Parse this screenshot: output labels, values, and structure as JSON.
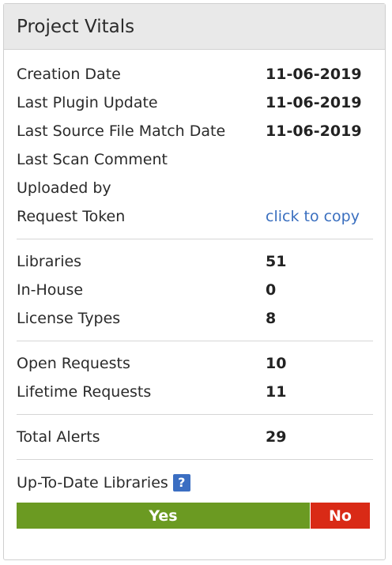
{
  "panel": {
    "title": "Project Vitals"
  },
  "sections": [
    [
      {
        "label": "Creation Date",
        "value": "11-06-2019"
      },
      {
        "label": "Last Plugin Update",
        "value": "11-06-2019"
      },
      {
        "label": "Last Source File Match Date",
        "value": "11-06-2019"
      },
      {
        "label": "Last Scan Comment",
        "value": ""
      },
      {
        "label": "Uploaded by",
        "value": ""
      },
      {
        "label": "Request Token",
        "link": "click to copy"
      }
    ],
    [
      {
        "label": "Libraries",
        "value": "51"
      },
      {
        "label": "In-House",
        "value": "0"
      },
      {
        "label": "License Types",
        "value": "8"
      }
    ],
    [
      {
        "label": "Open Requests",
        "value": "10"
      },
      {
        "label": "Lifetime Requests",
        "value": "11"
      }
    ],
    [
      {
        "label": "Total Alerts",
        "value": "29"
      }
    ]
  ],
  "uptodate": {
    "label": "Up-To-Date Libraries",
    "help_icon": "?",
    "yes_label": "Yes",
    "no_label": "No",
    "yes_fraction": 0.83,
    "colors": {
      "yes": "#6b9a22",
      "no": "#d92a16",
      "link": "#3a6fbf"
    }
  }
}
